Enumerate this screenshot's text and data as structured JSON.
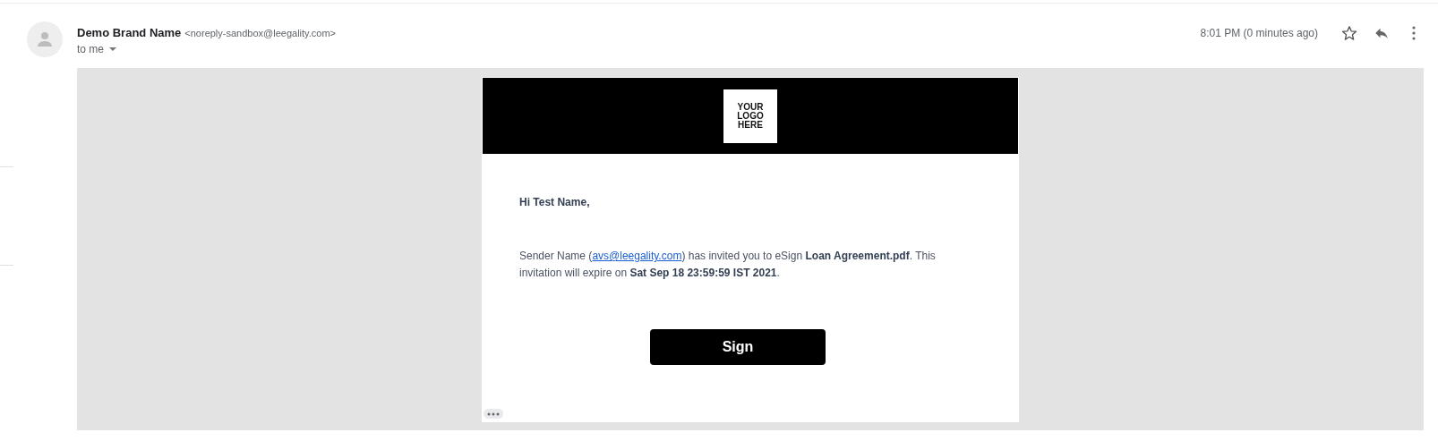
{
  "message": {
    "sender_name": "Demo Brand Name",
    "sender_email": "<noreply-sandbox@leegality.com>",
    "recipient": "to me",
    "time": "8:01 PM (0 minutes ago)",
    "starred": false
  },
  "email": {
    "logo": "YOUR LOGO HERE",
    "greeting": "Hi Test Name,",
    "paragraph": [
      {
        "kind": "plain",
        "text": "Sender Name ("
      },
      {
        "kind": "link",
        "text": "avs@leegality.com"
      },
      {
        "kind": "plain",
        "text": ") has invited you to eSign "
      },
      {
        "kind": "bold",
        "text": "Loan Agreement.pdf"
      },
      {
        "kind": "plain",
        "text": ". This invitation will expire on "
      },
      {
        "kind": "bold",
        "text": "Sat Sep 18 23:59:59 IST 2021"
      },
      {
        "kind": "plain",
        "text": "."
      }
    ],
    "button": "Sign"
  }
}
